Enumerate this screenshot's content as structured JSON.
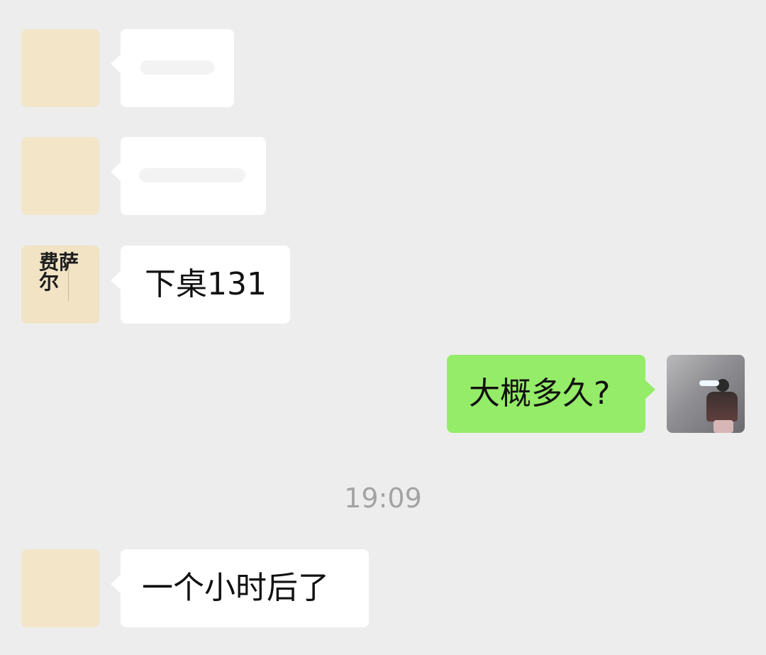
{
  "messages": [
    {
      "text": ""
    },
    {
      "text": ""
    },
    {
      "text": "下桌131"
    },
    {
      "text": "大概多久?"
    },
    {
      "text": "一个小时后了"
    }
  ],
  "timestamp": "19:09",
  "brand_avatar": {
    "label": "费萨尔"
  },
  "colors": {
    "background": "#ededed",
    "incoming_bubble": "#ffffff",
    "outgoing_bubble": "#95ec69",
    "timestamp": "#a3a3a3"
  }
}
